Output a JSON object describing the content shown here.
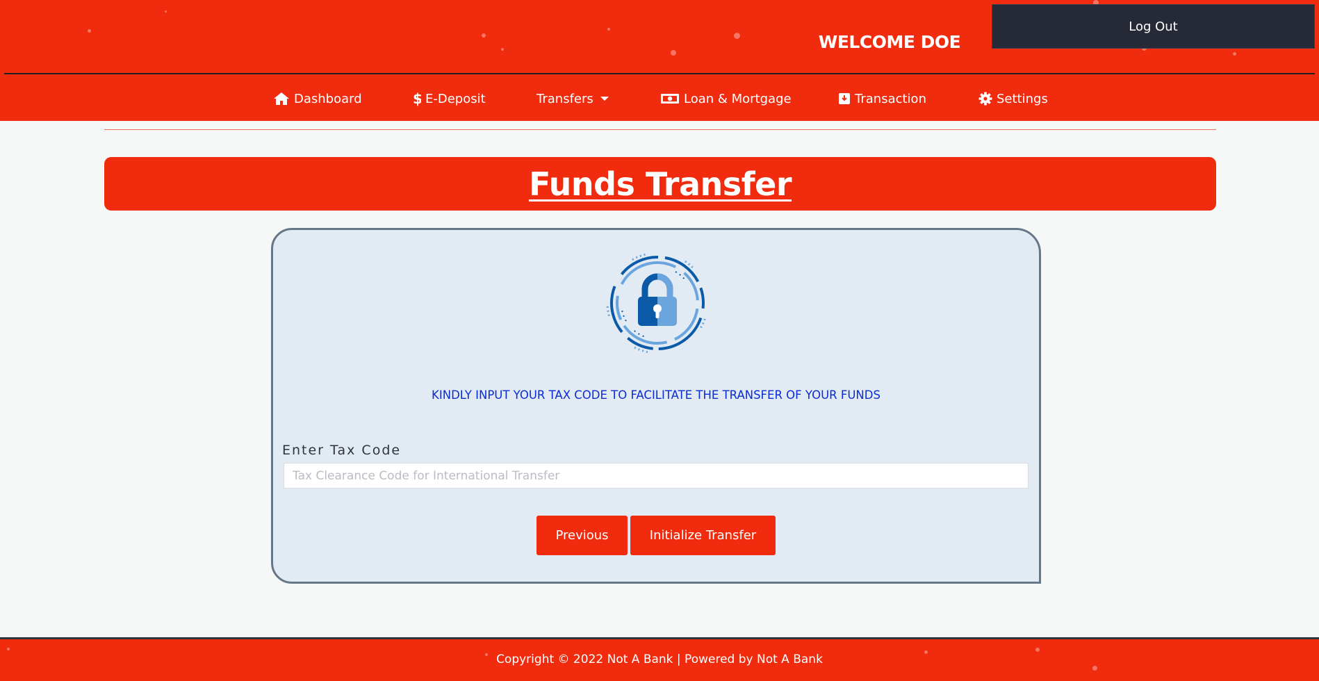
{
  "header": {
    "welcome": "WELCOME DOE",
    "logout_label": "Log Out"
  },
  "nav": {
    "items": [
      {
        "label": "Dashboard",
        "icon": "home-icon"
      },
      {
        "label": "E-Deposit",
        "icon": "dollar-icon"
      },
      {
        "label": "Transfers",
        "icon": "caret-down-icon"
      },
      {
        "label": "Loan & Mortgage",
        "icon": "money-bill-icon"
      },
      {
        "label": "Transaction",
        "icon": "archive-icon"
      },
      {
        "label": "Settings",
        "icon": "gear-icon"
      }
    ]
  },
  "page": {
    "title": "Funds Transfer"
  },
  "form": {
    "notice": "KINDLY INPUT YOUR TAX CODE TO FACILITATE THE TRANSFER OF YOUR FUNDS",
    "label": "Enter Tax Code",
    "placeholder": "Tax Clearance Code for International Transfer",
    "value": "",
    "previous_label": "Previous",
    "submit_label": "Initialize Transfer"
  },
  "footer": {
    "copyright": "Copyright © 2022 Not A Bank | Powered by Not A Bank"
  },
  "colors": {
    "brand_red": "#f02b0e",
    "dark_button": "#252a36",
    "card_bg": "#e2eaf3",
    "notice_blue": "#0b2bd4",
    "lock_dark_blue": "#0b5aa8",
    "lock_light_blue": "#6aa6dd"
  }
}
